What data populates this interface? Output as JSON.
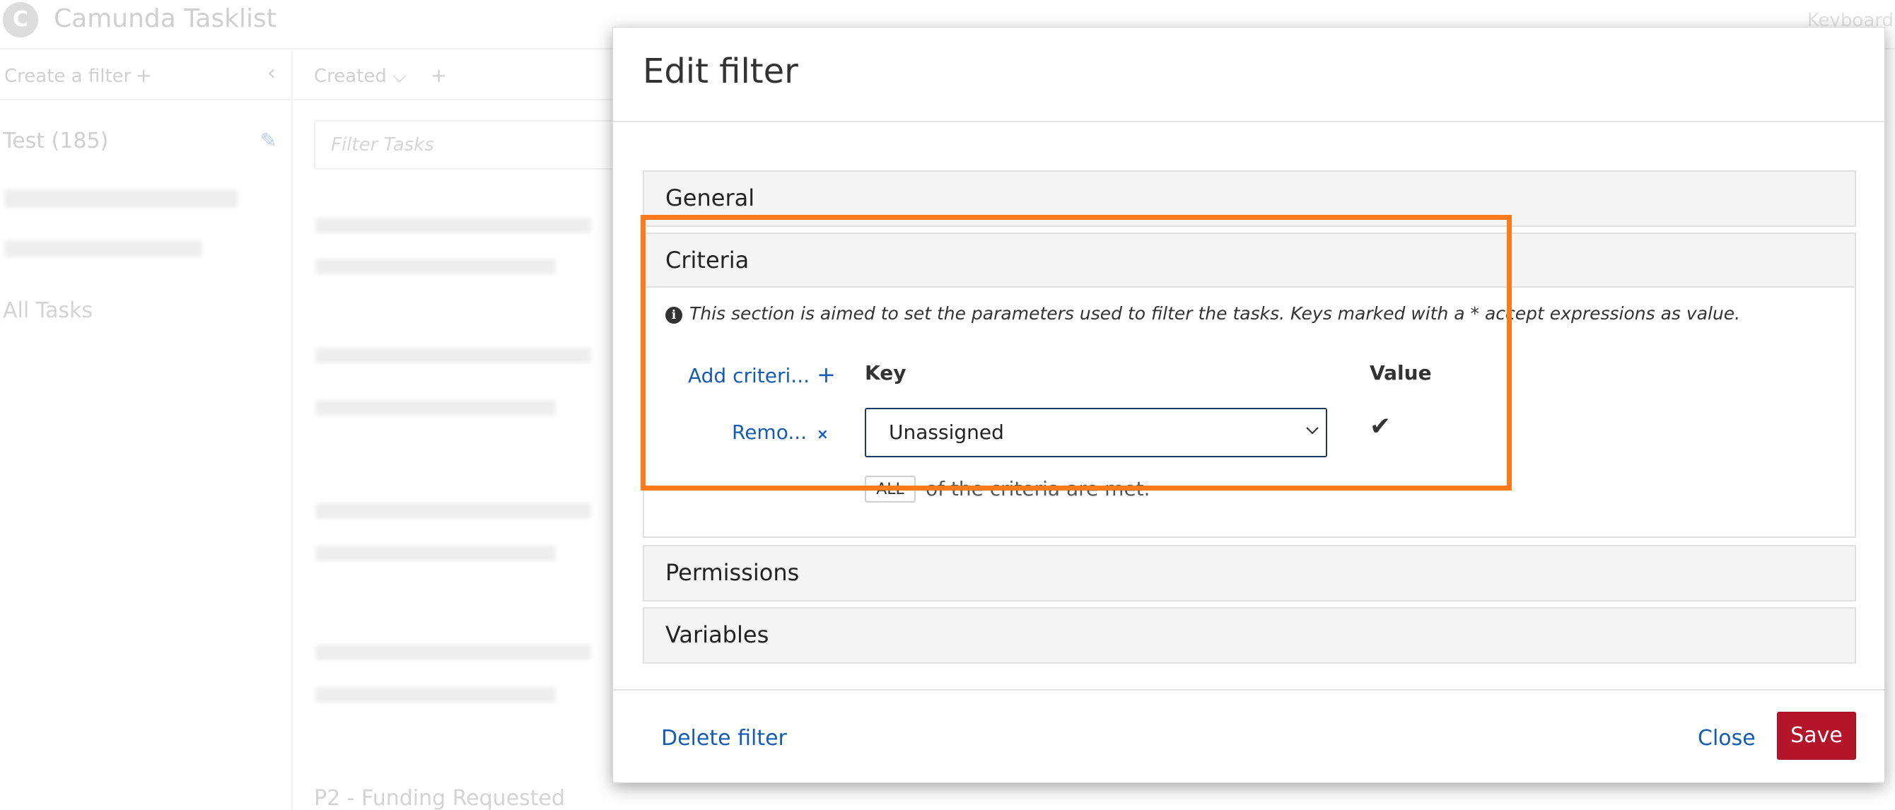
{
  "app": {
    "logo_glyph": "C",
    "title": "Camunda Tasklist",
    "keyboard_link": "Keyboard"
  },
  "sidebar": {
    "create_filter": "Create a filter",
    "plus": "+",
    "collapse_icon": "‹",
    "filters": [
      {
        "label": "Test (185)"
      },
      {
        "label": "All Tasks"
      }
    ]
  },
  "task_list": {
    "sort_label": "Created",
    "sort_chevron": "⌵",
    "plus": "+",
    "filter_placeholder": "Filter Tasks",
    "partial_task": "P2 - Funding Requested"
  },
  "modal": {
    "title": "Edit filter",
    "sections": {
      "general": "General",
      "criteria": "Criteria",
      "permissions": "Permissions",
      "variables": "Variables"
    },
    "criteria": {
      "info_icon": "i",
      "info_text": "This section is aimed to set the parameters used to filter the tasks. Keys marked with a * accept expressions as value.",
      "add_label": "Add criteri...",
      "add_plus": "+",
      "key_header": "Key",
      "value_header": "Value",
      "rows": [
        {
          "remove_label": "Remo...",
          "remove_x": "×",
          "key": "Unassigned",
          "value_check": "✔"
        }
      ],
      "match_mode": "ALL",
      "match_text": "of the criteria are met."
    },
    "footer": {
      "delete_label": "Delete filter",
      "close_label": "Close",
      "save_label": "Save"
    }
  },
  "colors": {
    "accent_link": "#155cb5",
    "save_button": "#b5152b",
    "highlight": "#ff7a1a"
  }
}
